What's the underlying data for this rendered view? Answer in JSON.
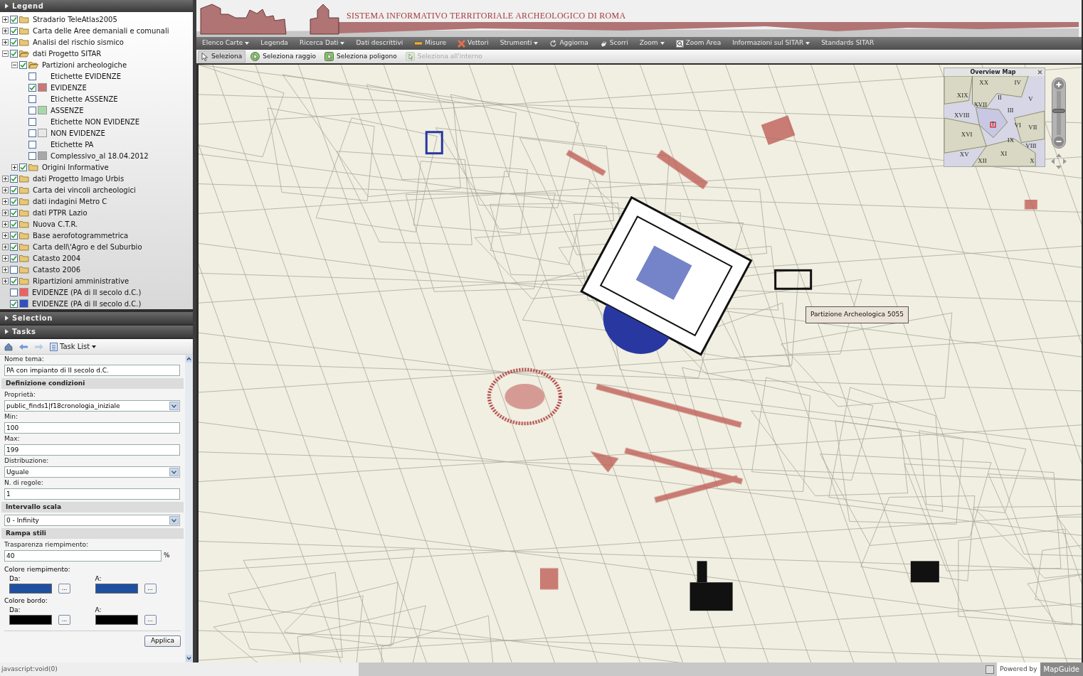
{
  "legend": {
    "title": "Legend",
    "items": [
      {
        "kind": "folder",
        "label": "Stradario TeleAtlas2005",
        "checked": true,
        "expanded": false
      },
      {
        "kind": "folder",
        "label": "Carta delle Aree demaniali e comunali",
        "checked": true,
        "expanded": false
      },
      {
        "kind": "folder",
        "label": "Analisi del rischio sismico",
        "checked": true,
        "expanded": false
      },
      {
        "kind": "folder",
        "label": "dati Progetto SITAR",
        "checked": true,
        "expanded": true,
        "children": [
          {
            "kind": "folder",
            "label": "Partizioni archeologiche",
            "checked": true,
            "expanded": true,
            "children": [
              {
                "kind": "layer",
                "label": "Etichette EVIDENZE",
                "checked": false
              },
              {
                "kind": "layer",
                "label": "EVIDENZE",
                "checked": true,
                "color": "#c87878"
              },
              {
                "kind": "layer",
                "label": "Etichette ASSENZE",
                "checked": false
              },
              {
                "kind": "layer",
                "label": "ASSENZE",
                "checked": false,
                "color": "#a8d8a8"
              },
              {
                "kind": "layer",
                "label": "Etichette NON EVIDENZE",
                "checked": false
              },
              {
                "kind": "layer",
                "label": "NON EVIDENZE",
                "checked": false,
                "color": "#e8e8e8"
              },
              {
                "kind": "layer",
                "label": "Etichette PA",
                "checked": false
              },
              {
                "kind": "layer",
                "label": "Complessivo_al 18.04.2012",
                "checked": false,
                "color": "#a8a8a8"
              }
            ]
          },
          {
            "kind": "folder",
            "label": "Origini Informative",
            "checked": true,
            "expanded": false
          }
        ]
      },
      {
        "kind": "folder",
        "label": "dati Progetto Imago Urbis",
        "checked": true,
        "expanded": false
      },
      {
        "kind": "folder",
        "label": "Carta dei vincoli archeologici",
        "checked": true,
        "expanded": false
      },
      {
        "kind": "folder",
        "label": "dati indagini Metro C",
        "checked": true,
        "expanded": false
      },
      {
        "kind": "folder",
        "label": "dati PTPR Lazio",
        "checked": true,
        "expanded": false
      },
      {
        "kind": "folder",
        "label": "Nuova C.T.R.",
        "checked": true,
        "expanded": false
      },
      {
        "kind": "folder",
        "label": "Base aerofotogrammetrica",
        "checked": true,
        "expanded": false
      },
      {
        "kind": "folder",
        "label": "Carta dell\\'Agro e del Suburbio",
        "checked": true,
        "expanded": false
      },
      {
        "kind": "folder",
        "label": "Catasto 2004",
        "checked": true,
        "expanded": false
      },
      {
        "kind": "folder",
        "label": "Catasto 2006",
        "checked": false,
        "expanded": false
      },
      {
        "kind": "folder",
        "label": "Ripartizioni amministrative",
        "checked": true,
        "expanded": false
      },
      {
        "kind": "layer",
        "label": "EVIDENZE (PA di II secolo d.C.)",
        "checked": false,
        "color": "#f06060"
      },
      {
        "kind": "layer",
        "label": "EVIDENZE (PA di II secolo d.C.)",
        "checked": true,
        "color": "#3050c0"
      }
    ]
  },
  "panels": [
    "Selection",
    "Tasks"
  ],
  "task_toolbar": {
    "task_list": "Task List"
  },
  "task_form": [
    {
      "kind": "label",
      "text": "Nome tema:"
    },
    {
      "kind": "input",
      "value": "PA con impianto di II secolo d.C."
    },
    {
      "kind": "section",
      "text": "Definizione condizioni"
    },
    {
      "kind": "label",
      "text": "Proprietà:"
    },
    {
      "kind": "select",
      "value": "public_finds1|f18cronologia_iniziale"
    },
    {
      "kind": "label",
      "text": "Min:"
    },
    {
      "kind": "input",
      "value": "100"
    },
    {
      "kind": "label",
      "text": "Max:"
    },
    {
      "kind": "input",
      "value": "199"
    },
    {
      "kind": "label",
      "text": "Distribuzione:"
    },
    {
      "kind": "select",
      "value": "Uguale"
    },
    {
      "kind": "label",
      "text": "N. di regole:"
    },
    {
      "kind": "input",
      "value": "1"
    },
    {
      "kind": "section",
      "text": "Intervallo scala"
    },
    {
      "kind": "select",
      "value": "0 - Infinity"
    },
    {
      "kind": "section",
      "text": "Rampa stili"
    },
    {
      "kind": "label",
      "text": "Trasparenza riempimento:"
    },
    {
      "kind": "input_suffix",
      "value": "40",
      "suffix": "%"
    },
    {
      "kind": "colors",
      "text": "Colore riempimento:",
      "from": {
        "label": "Da:",
        "color": "#1f4fa0",
        "button": "..."
      },
      "to": {
        "label": "A:",
        "color": "#1f4fa0",
        "button": "..."
      }
    },
    {
      "kind": "colors",
      "text": "Colore bordo:",
      "from": {
        "label": "Da:",
        "color": "#000000",
        "button": "..."
      },
      "to": {
        "label": "A:",
        "color": "#000000",
        "button": "..."
      }
    }
  ],
  "apply_button": "Applica",
  "banner": {
    "title": "SISTEMA INFORMATIVO TERRITORIALE ARCHEOLOGICO DI ROMA"
  },
  "menu": [
    {
      "label": "Elenco Carte",
      "dropdown": true
    },
    {
      "label": "Legenda",
      "dropdown": false
    },
    {
      "label": "Ricerca Dati",
      "dropdown": true
    },
    {
      "label": "Dati descrittivi",
      "dropdown": false
    },
    {
      "label": "Misure",
      "dropdown": false
    },
    {
      "label": "Vettori",
      "dropdown": false
    },
    {
      "label": "Strumenti",
      "dropdown": true
    },
    {
      "label": "Aggiorna",
      "dropdown": false
    },
    {
      "label": "Scorri",
      "dropdown": false
    },
    {
      "label": "Zoom",
      "dropdown": true
    },
    {
      "label": "Zoom Area",
      "dropdown": false
    },
    {
      "label": "Informazioni sul SITAR",
      "dropdown": true
    },
    {
      "label": "Standards SITAR",
      "dropdown": false
    }
  ],
  "select_tools": [
    {
      "label": "Seleziona",
      "selected": true,
      "disabled": false
    },
    {
      "label": "Seleziona raggio",
      "selected": false,
      "disabled": false
    },
    {
      "label": "Seleziona poligono",
      "selected": false,
      "disabled": false
    },
    {
      "label": "Seleziona all'interno",
      "selected": false,
      "disabled": true
    }
  ],
  "overview_map": {
    "title": "Overview Map",
    "regions": [
      "XX",
      "IV",
      "XIX",
      "II",
      "XVII",
      "V",
      "III",
      "XVIII",
      "I",
      "VI",
      "VII",
      "XVI",
      "IX",
      "VIII",
      "XV",
      "XI",
      "XII",
      "X"
    ]
  },
  "zoom_slider": {
    "level": 0.55
  },
  "map_tooltip": "Partizione Archeologica 5055",
  "status_bar": {
    "text": "javascript:void(0)",
    "powered_by": "Powered by",
    "brand": "MapGuide"
  }
}
